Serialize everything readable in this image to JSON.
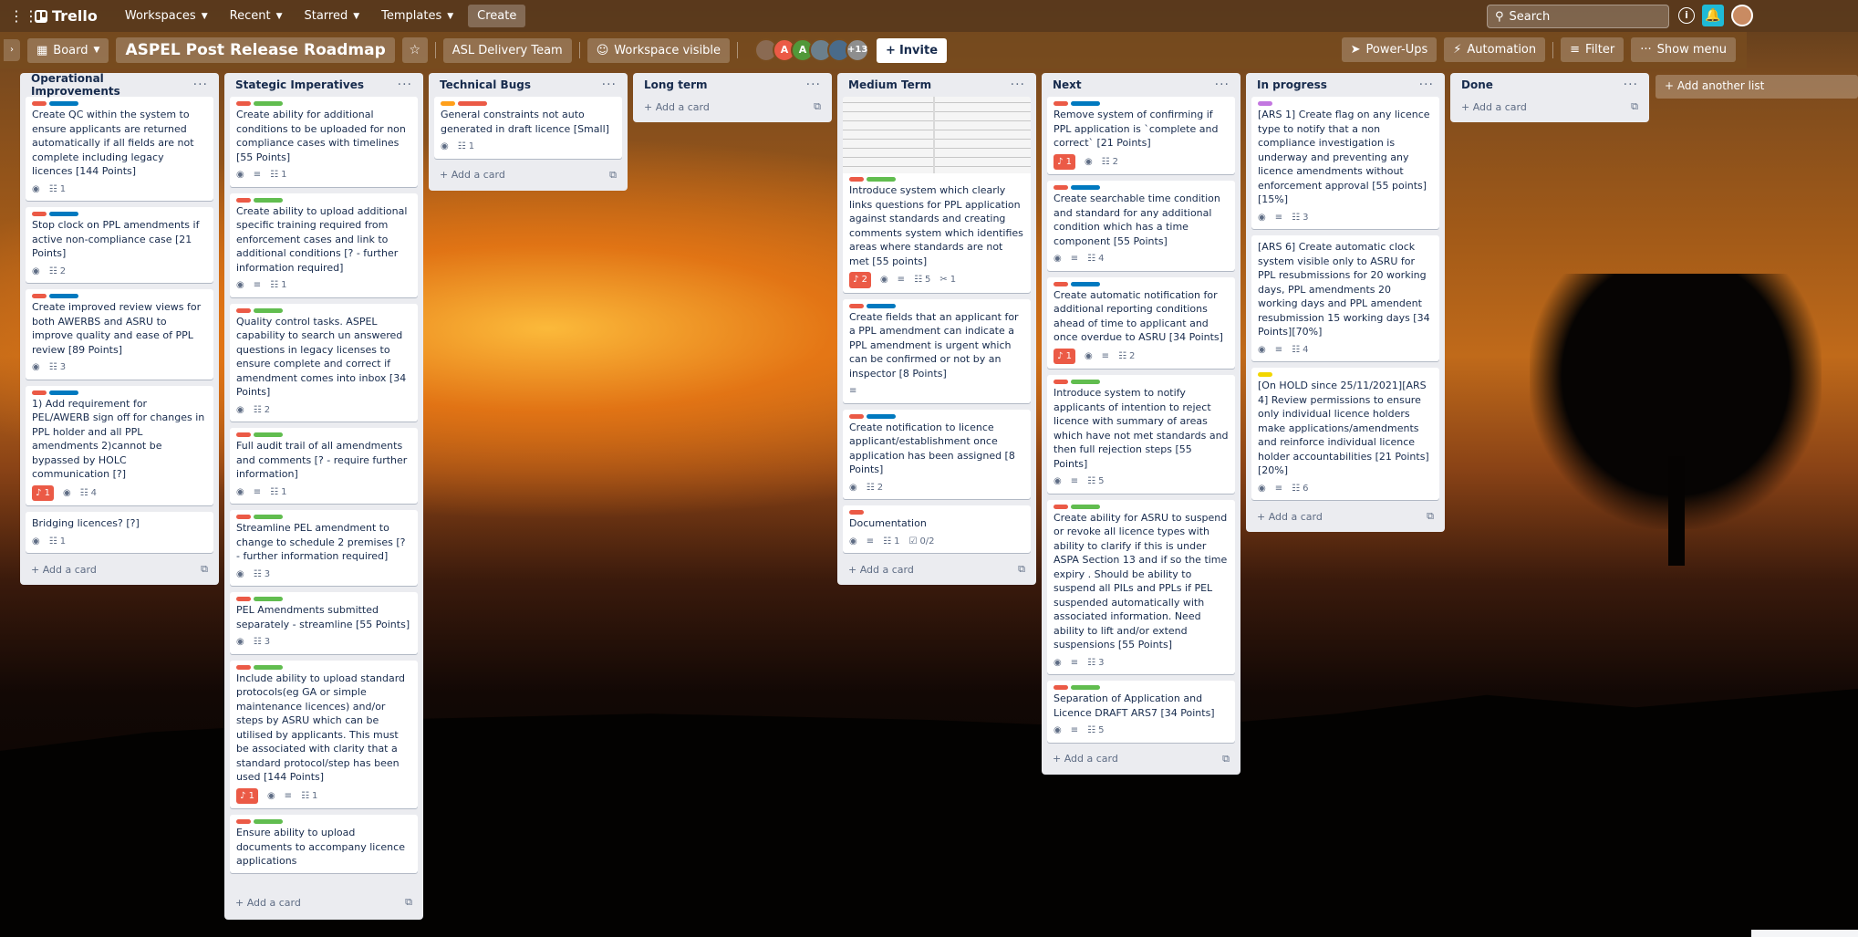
{
  "nav": {
    "logo": "Trello",
    "items": [
      "Workspaces",
      "Recent",
      "Starred",
      "Templates"
    ],
    "create": "Create",
    "search_placeholder": "Search"
  },
  "board": {
    "view": "Board",
    "title": "ASPEL Post Release Roadmap",
    "team": "ASL Delivery Team",
    "visibility": "Workspace visible",
    "avatar_initials": [
      "A",
      "A"
    ],
    "more_members": "+13",
    "invite": "Invite",
    "power_ups": "Power-Ups",
    "automation": "Automation",
    "filter": "Filter",
    "show_menu": "Show menu"
  },
  "add_card": "Add a card",
  "add_list": "Add another list",
  "lists": [
    {
      "title": "Operational Improvements",
      "cards": [
        {
          "labels": [
            "red",
            "blue"
          ],
          "text": "Create QC within the system to ensure applicants are returned automatically if all fields are not complete including legacy licences [144 Points]",
          "badges": {
            "comments": "1"
          }
        },
        {
          "labels": [
            "red",
            "blue"
          ],
          "text": "Stop clock on PPL amendments if active non-compliance case [21 Points]",
          "badges": {
            "comments": "2"
          }
        },
        {
          "labels": [
            "red",
            "blue"
          ],
          "text": "Create improved review views for both AWERBS and ASRU to improve quality and ease of PPL review [89 Points]",
          "badges": {
            "comments": "3"
          }
        },
        {
          "labels": [
            "red",
            "blue"
          ],
          "text": "1) Add requirement for PEL/AWERB sign off for changes in PPL holder and all PPL amendments 2)cannot be bypassed by HOLC communication [?]",
          "badges": {
            "alert": "1",
            "comments": "4"
          }
        },
        {
          "labels": [],
          "text": "Bridging licences? [?]",
          "badges": {
            "comments": "1"
          }
        }
      ]
    },
    {
      "title": "Stategic Imperatives",
      "cards": [
        {
          "labels": [
            "red",
            "green"
          ],
          "text": "Create ability for additional conditions to be uploaded for non compliance cases with timelines [55 Points]",
          "badges": {
            "desc": true,
            "comments": "1"
          }
        },
        {
          "labels": [
            "red",
            "green"
          ],
          "text": "Create ability to upload additional specific training required from enforcement cases and link to additional conditions [? - further information required]",
          "badges": {
            "desc": true,
            "comments": "1"
          }
        },
        {
          "labels": [
            "red",
            "green"
          ],
          "text": "Quality control tasks. ASPEL capability to search un answered questions in legacy licenses to ensure complete and correct if amendment comes into inbox [34 Points]",
          "badges": {
            "comments": "2"
          }
        },
        {
          "labels": [
            "red",
            "green"
          ],
          "text": "Full audit trail of all amendments and comments [? - require further information]",
          "badges": {
            "desc": true,
            "comments": "1"
          }
        },
        {
          "labels": [
            "red",
            "green"
          ],
          "text": "Streamline PEL amendment to change to schedule 2 premises [? - further information required]",
          "badges": {
            "comments": "3"
          }
        },
        {
          "labels": [
            "red",
            "green"
          ],
          "text": "PEL Amendments submitted separately - streamline [55 Points]",
          "badges": {
            "comments": "3"
          }
        },
        {
          "labels": [
            "red",
            "green"
          ],
          "text": "Include ability to upload standard protocols(eg GA or simple maintenance licences) and/or steps by ASRU which can be utilised by applicants. This must be associated with clarity that a standard protocol/step has been used [144 Points]",
          "badges": {
            "alert": "1",
            "desc": true,
            "comments": "1"
          }
        },
        {
          "labels": [
            "red",
            "green"
          ],
          "text": "Ensure ability to upload documents to accompany licence applications",
          "badges": {}
        }
      ]
    },
    {
      "title": "Technical Bugs",
      "cards": [
        {
          "labels": [
            "orange",
            "red"
          ],
          "text": "General constraints not auto generated in draft licence [Small]",
          "badges": {
            "comments": "1"
          }
        }
      ]
    },
    {
      "title": "Long term",
      "cards": []
    },
    {
      "title": "Medium Term",
      "cards": [
        {
          "cover": true,
          "labels": [
            "red",
            "green"
          ],
          "text": "Introduce system which clearly links questions for PPL application against standards and creating comments system which identifies areas where standards are not met [55 points]",
          "badges": {
            "alert": "2",
            "desc": true,
            "comments": "5",
            "attach": "1"
          }
        },
        {
          "labels": [
            "red",
            "blue"
          ],
          "text": "Create fields that an applicant for a PPL amendment can indicate a PPL amendment is urgent which can be confirmed or not by an inspector [8 Points]",
          "badges": {
            "desc_only": true
          }
        },
        {
          "labels": [
            "red",
            "blue"
          ],
          "text": "Create notification to licence applicant/establishment once application has been assigned [8 Points]",
          "badges": {
            "comments": "2"
          }
        },
        {
          "labels": [
            "red"
          ],
          "text": "Documentation",
          "badges": {
            "desc": true,
            "comments": "1",
            "check": "0/2"
          }
        }
      ]
    },
    {
      "title": "Next",
      "cards": [
        {
          "labels": [
            "red",
            "blue"
          ],
          "text": "Remove system of confirming if PPL application is `complete and correct` [21 Points]",
          "badges": {
            "alert": "1",
            "comments": "2"
          }
        },
        {
          "labels": [
            "red",
            "blue"
          ],
          "text": "Create searchable time condition and standard for any additional condition which has a time component [55 Points]",
          "badges": {
            "desc": true,
            "comments": "4"
          }
        },
        {
          "labels": [
            "red",
            "blue"
          ],
          "text": "Create automatic notification for additional reporting conditions ahead of time to applicant and once overdue to ASRU [34 Points]",
          "badges": {
            "alert": "1",
            "desc": true,
            "comments": "2"
          }
        },
        {
          "labels": [
            "red",
            "green"
          ],
          "text": "Introduce system to notify applicants of intention to reject licence with summary of areas which have not met standards and then full rejection steps [55 Points]",
          "badges": {
            "desc": true,
            "comments": "5"
          }
        },
        {
          "labels": [
            "red",
            "green"
          ],
          "text": "Create ability for ASRU to suspend or revoke all licence types with ability to clarify if this is under ASPA Section 13 and if so the time expiry . Should be ability to suspend all PILs and PPLs if PEL suspended automatically with associated information. Need ability to lift and/or extend suspensions [55 Points]",
          "badges": {
            "desc": true,
            "comments": "3"
          }
        },
        {
          "labels": [
            "red",
            "green"
          ],
          "text": "Separation of Application and Licence DRAFT ARS7 [34 Points]",
          "badges": {
            "desc": true,
            "comments": "5"
          }
        }
      ]
    },
    {
      "title": "In progress",
      "cards": [
        {
          "labels": [
            "purple"
          ],
          "text": "[ARS 1] Create flag on any licence type to notify that a non compliance investigation is underway and preventing any licence amendments without enforcement approval [55 points][15%]",
          "badges": {
            "desc": true,
            "comments": "3"
          }
        },
        {
          "labels": [],
          "text": "[ARS 6] Create automatic clock system visible only to ASRU for PPL resubmissions for 20 working days, PPL amendments 20 working days and PPL amendent resubmission 15 working days [34 Points][70%]",
          "badges": {
            "desc": true,
            "comments": "4"
          }
        },
        {
          "labels": [
            "yellow"
          ],
          "text": "[On HOLD since 25/11/2021][ARS 4] Review permissions to ensure only individual licence holders make applications/amendments and reinforce individual licence holder accountabilities [21 Points][20%]",
          "badges": {
            "desc": true,
            "comments": "6"
          }
        }
      ]
    },
    {
      "title": "Done",
      "cards": []
    }
  ]
}
